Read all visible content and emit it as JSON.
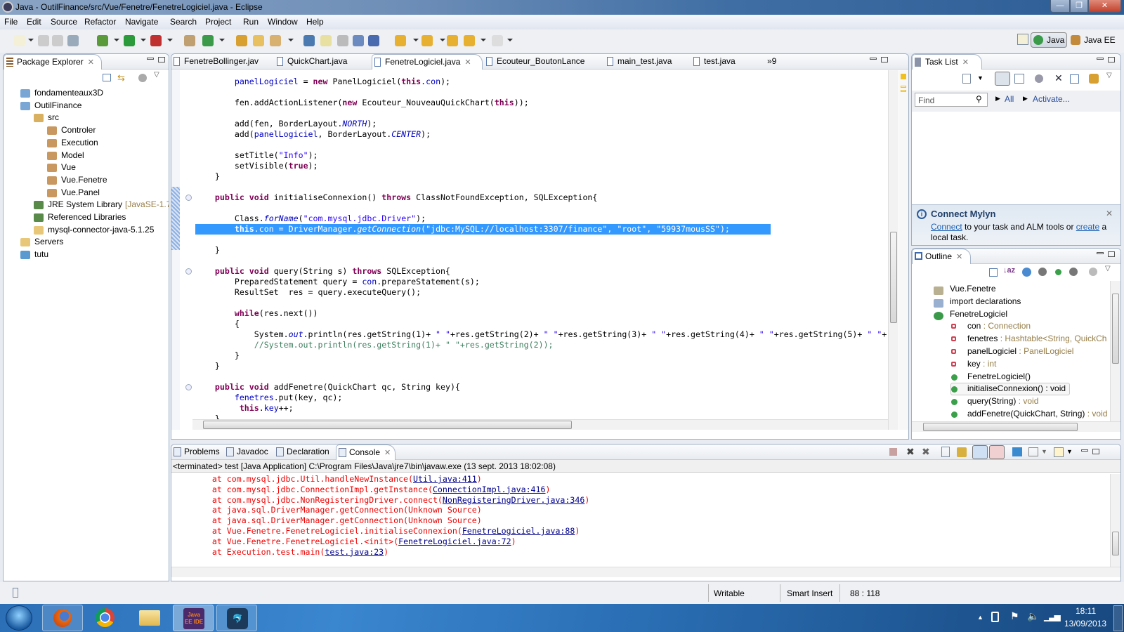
{
  "window": {
    "title": "Java - OutilFinance/src/Vue/Fenetre/FenetreLogiciel.java - Eclipse",
    "minimize": "—",
    "restore": "❐",
    "close": "✕"
  },
  "menu": [
    "File",
    "Edit",
    "Source",
    "Refactor",
    "Navigate",
    "Search",
    "Project",
    "Run",
    "Window",
    "Help"
  ],
  "perspectives": {
    "java": "Java",
    "java_ee": "Java EE",
    "active": "Java"
  },
  "package_explorer": {
    "title": "Package Explorer",
    "items": [
      {
        "label": "fondamenteaux3D",
        "level": 0,
        "icon": "project-folder-icon"
      },
      {
        "label": "OutilFinance",
        "level": 0,
        "icon": "project-folder-icon"
      },
      {
        "label": "src",
        "level": 1,
        "icon": "source-folder-icon"
      },
      {
        "label": "Controler",
        "level": 2,
        "icon": "package-icon"
      },
      {
        "label": "Execution",
        "level": 2,
        "icon": "package-icon"
      },
      {
        "label": "Model",
        "level": 2,
        "icon": "package-icon"
      },
      {
        "label": "Vue",
        "level": 2,
        "icon": "package-icon"
      },
      {
        "label": "Vue.Fenetre",
        "level": 2,
        "icon": "package-icon"
      },
      {
        "label": "Vue.Panel",
        "level": 2,
        "icon": "package-icon"
      },
      {
        "label": "JRE System Library",
        "suffix": "[JavaSE-1.7]",
        "level": 1,
        "icon": "library-icon"
      },
      {
        "label": "Referenced Libraries",
        "level": 1,
        "icon": "library-icon"
      },
      {
        "label": "mysql-connector-java-5.1.25",
        "level": 1,
        "icon": "folder-icon"
      },
      {
        "label": "Servers",
        "level": 0,
        "icon": "folder-icon"
      },
      {
        "label": "tutu",
        "level": 0,
        "icon": "web-project-icon"
      }
    ]
  },
  "editor": {
    "tabs": [
      {
        "label": "FenetreBollinger.jav"
      },
      {
        "label": "QuickChart.java"
      },
      {
        "label": "FenetreLogiciel.java",
        "active": true
      },
      {
        "label": "Ecouteur_BoutonLance"
      },
      {
        "label": "main_test.java"
      },
      {
        "label": "test.java"
      }
    ],
    "overflow": "»9",
    "selected_line": 14,
    "lines": [
      [
        [
          "p",
          "        "
        ],
        [
          "field",
          "panelLogiciel"
        ],
        [
          "p",
          " = "
        ],
        [
          "kw",
          "new"
        ],
        [
          "p",
          " PanelLogiciel("
        ],
        [
          "kw",
          "this"
        ],
        [
          "p",
          "."
        ],
        [
          "field",
          "con"
        ],
        [
          "p",
          ");"
        ]
      ],
      [],
      [
        [
          "p",
          "        fen.addActionListener("
        ],
        [
          "kw",
          "new"
        ],
        [
          "p",
          " Ecouteur_NouveauQuickChart("
        ],
        [
          "kw",
          "this"
        ],
        [
          "p",
          "));"
        ]
      ],
      [],
      [
        [
          "p",
          "        add(fen, BorderLayout."
        ],
        [
          "static",
          "NORTH"
        ],
        [
          "p",
          ");"
        ]
      ],
      [
        [
          "p",
          "        add("
        ],
        [
          "field",
          "panelLogiciel"
        ],
        [
          "p",
          ", BorderLayout."
        ],
        [
          "static",
          "CENTER"
        ],
        [
          "p",
          ");"
        ]
      ],
      [],
      [
        [
          "p",
          "        setTitle("
        ],
        [
          "str",
          "\"Info\""
        ],
        [
          "p",
          ");"
        ]
      ],
      [
        [
          "p",
          "        setVisible("
        ],
        [
          "kw",
          "true"
        ],
        [
          "p",
          ");"
        ]
      ],
      [
        [
          "p",
          "    }"
        ]
      ],
      [],
      [
        [
          "p",
          "    "
        ],
        [
          "kw",
          "public"
        ],
        [
          "p",
          " "
        ],
        [
          "kw",
          "void"
        ],
        [
          "p",
          " initialiseConnexion() "
        ],
        [
          "kw",
          "throws"
        ],
        [
          "p",
          " ClassNotFoundException, SQLException{"
        ]
      ],
      [],
      [
        [
          "p",
          "        Class."
        ],
        [
          "static",
          "forName"
        ],
        [
          "p",
          "("
        ],
        [
          "str",
          "\"com.mysql.jdbc.Driver\""
        ],
        [
          "p",
          ");"
        ]
      ],
      [
        [
          "p",
          "        "
        ],
        [
          "kw",
          "this"
        ],
        [
          "p",
          "."
        ],
        [
          "field",
          "con"
        ],
        [
          "p",
          " = DriverManager."
        ],
        [
          "static",
          "getConnection"
        ],
        [
          "p",
          "("
        ],
        [
          "str",
          "\"jdbc:MySQL://localhost:3307/finance\""
        ],
        [
          "p",
          ", "
        ],
        [
          "str",
          "\"root\""
        ],
        [
          "p",
          ", "
        ],
        [
          "str",
          "\"59937mousSS\""
        ],
        [
          "p",
          ");"
        ]
      ],
      [],
      [
        [
          "p",
          "    }"
        ]
      ],
      [],
      [
        [
          "p",
          "    "
        ],
        [
          "kw",
          "public"
        ],
        [
          "p",
          " "
        ],
        [
          "kw",
          "void"
        ],
        [
          "p",
          " query(String s) "
        ],
        [
          "kw",
          "throws"
        ],
        [
          "p",
          " SQLException{"
        ]
      ],
      [
        [
          "p",
          "        PreparedStatement query = "
        ],
        [
          "field",
          "con"
        ],
        [
          "p",
          ".prepareStatement(s);"
        ]
      ],
      [
        [
          "p",
          "        ResultSet  res = query.executeQuery();"
        ]
      ],
      [],
      [
        [
          "p",
          "        "
        ],
        [
          "kw",
          "while"
        ],
        [
          "p",
          "(res.next())"
        ]
      ],
      [
        [
          "p",
          "        {"
        ]
      ],
      [
        [
          "p",
          "            System."
        ],
        [
          "static",
          "out"
        ],
        [
          "p",
          ".println(res.getString(1)+ "
        ],
        [
          "str",
          "\" \""
        ],
        [
          "p",
          "+res.getString(2)+ "
        ],
        [
          "str",
          "\" \""
        ],
        [
          "p",
          "+res.getString(3)+ "
        ],
        [
          "str",
          "\" \""
        ],
        [
          "p",
          "+res.getString(4)+ "
        ],
        [
          "str",
          "\" \""
        ],
        [
          "p",
          "+res.getString(5)+ "
        ],
        [
          "str",
          "\" \""
        ],
        [
          "p",
          "+"
        ]
      ],
      [
        [
          "comment",
          "            //System.out.println(res.getString(1)+ \" \"+res.getString(2));"
        ]
      ],
      [
        [
          "p",
          "        }"
        ]
      ],
      [
        [
          "p",
          "    }"
        ]
      ],
      [],
      [
        [
          "p",
          "    "
        ],
        [
          "kw",
          "public"
        ],
        [
          "p",
          " "
        ],
        [
          "kw",
          "void"
        ],
        [
          "p",
          " addFenetre(QuickChart qc, String key){"
        ]
      ],
      [
        [
          "p",
          "        "
        ],
        [
          "field",
          "fenetres"
        ],
        [
          "p",
          ".put(key, qc);"
        ]
      ],
      [
        [
          "p",
          "         "
        ],
        [
          "kw",
          "this"
        ],
        [
          "p",
          "."
        ],
        [
          "field",
          "key"
        ],
        [
          "p",
          "++;"
        ]
      ],
      [
        [
          "p",
          "    }"
        ]
      ]
    ]
  },
  "task_list": {
    "title": "Task List",
    "find_placeholder": "Find",
    "all_label": "All",
    "activate_label": "Activate...",
    "mylyn": {
      "title": "Connect Mylyn",
      "connect": "Connect",
      "text1": " to your task and ALM tools or ",
      "create": "create",
      "text2": " a local task."
    }
  },
  "outline": {
    "title": "Outline",
    "items": [
      {
        "name": "Vue.Fenetre",
        "type": "",
        "level": 0,
        "icon": "package-icon"
      },
      {
        "name": "import declarations",
        "type": "",
        "level": 0,
        "icon": "imports-icon"
      },
      {
        "name": "FenetreLogiciel",
        "type": "",
        "level": 0,
        "icon": "class-icon"
      },
      {
        "name": "con",
        "type": " : Connection",
        "level": 1,
        "icon": "private-field-icon"
      },
      {
        "name": "fenetres",
        "type": " : Hashtable<String, QuickCh",
        "level": 1,
        "icon": "private-field-icon"
      },
      {
        "name": "panelLogiciel",
        "type": " : PanelLogiciel",
        "level": 1,
        "icon": "private-field-icon"
      },
      {
        "name": "key",
        "type": " : int",
        "level": 1,
        "icon": "private-field-icon"
      },
      {
        "name": "FenetreLogiciel()",
        "type": "",
        "level": 1,
        "icon": "constructor-icon"
      },
      {
        "name": "initialiseConnexion() : void",
        "type": "",
        "level": 1,
        "icon": "public-method-icon",
        "selected": true
      },
      {
        "name": "query(String)",
        "type": " : void",
        "level": 1,
        "icon": "public-method-icon"
      },
      {
        "name": "addFenetre(QuickChart, String)",
        "type": " : void",
        "level": 1,
        "icon": "public-method-icon"
      }
    ]
  },
  "bottom": {
    "tabs": [
      {
        "label": "Problems"
      },
      {
        "label": "Javadoc"
      },
      {
        "label": "Declaration"
      },
      {
        "label": "Console",
        "active": true
      }
    ],
    "console_header": "<terminated> test [Java Application] C:\\Program Files\\Java\\jre7\\bin\\javaw.exe (13 sept. 2013 18:02:08)",
    "lines": [
      [
        "        at com.mysql.jdbc.Util.handleNewInstance(",
        "Util.java:411",
        ")"
      ],
      [
        "        at com.mysql.jdbc.ConnectionImpl.getInstance(",
        "ConnectionImpl.java:416",
        ")"
      ],
      [
        "        at com.mysql.jdbc.NonRegisteringDriver.connect(",
        "NonRegisteringDriver.java:346",
        ")"
      ],
      [
        "        at java.sql.DriverManager.getConnection(Unknown Source)",
        "",
        ""
      ],
      [
        "        at java.sql.DriverManager.getConnection(Unknown Source)",
        "",
        ""
      ],
      [
        "        at Vue.Fenetre.FenetreLogiciel.initialiseConnexion(",
        "FenetreLogiciel.java:88",
        ")"
      ],
      [
        "        at Vue.Fenetre.FenetreLogiciel.<init>(",
        "FenetreLogiciel.java:72",
        ")"
      ],
      [
        "        at Execution.test.main(",
        "test.java:23",
        ")"
      ]
    ]
  },
  "status": {
    "writable": "Writable",
    "insert_mode": "Smart Insert",
    "position": "88 : 118"
  },
  "taskbar": {
    "apps": [
      "Firefox",
      "Chrome",
      "Windows Explorer",
      "Java EE IDE",
      "MySQL Workbench"
    ],
    "java_ee_badge": "Java EE IDE",
    "time": "18:11",
    "date": "13/09/2013"
  },
  "colors": {
    "selection": "#3399ff",
    "keyword": "#7f0055",
    "field": "#0000c0",
    "string": "#2a00ff",
    "comment": "#3f7f5f",
    "console_error": "#ee0000"
  }
}
